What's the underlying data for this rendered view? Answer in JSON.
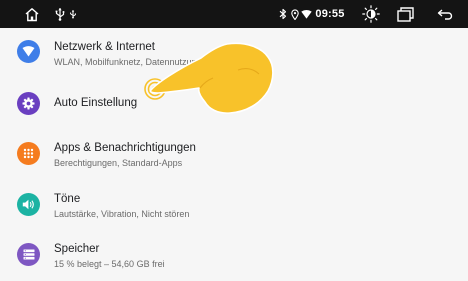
{
  "status_bar": {
    "time": "09:55",
    "icons": [
      "home-icon",
      "usb-icon",
      "usb-small-icon",
      "bluetooth-icon",
      "location-icon",
      "wifi-icon",
      "brightness-icon",
      "recent-apps-icon",
      "back-icon"
    ]
  },
  "settings": {
    "items": [
      {
        "title": "Netzwerk & Internet",
        "subtitle": "WLAN, Mobilfunknetz, Datennutzung",
        "icon": "wifi-icon",
        "color": "#3f7ee8"
      },
      {
        "title": "Auto Einstellung",
        "subtitle": "",
        "icon": "gear-icon",
        "color": "#6a3fc0"
      },
      {
        "title": "Apps & Benachrichtigungen",
        "subtitle": "Berechtigungen, Standard-Apps",
        "icon": "apps-grid-icon",
        "color": "#f57c1f"
      },
      {
        "title": "Töne",
        "subtitle": "Lautstärke, Vibration, Nicht stören",
        "icon": "volume-icon",
        "color": "#1cb3a3"
      },
      {
        "title": "Speicher",
        "subtitle": "15 % belegt – 54,60 GB frei",
        "icon": "storage-icon",
        "color": "#7e57c2"
      }
    ]
  },
  "colors": {
    "status_bar_bg": "#141414",
    "background": "#f6f6f6",
    "hand_overlay": "#f8c22a"
  }
}
